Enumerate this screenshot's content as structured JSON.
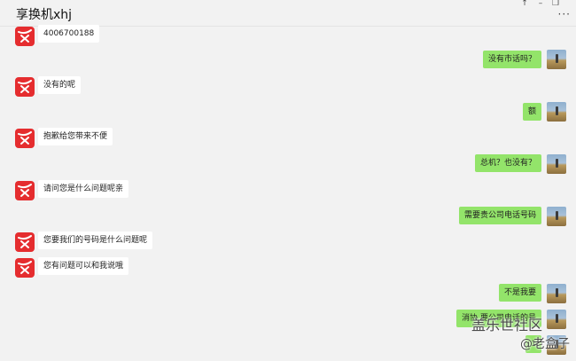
{
  "window": {
    "title": "享换机xhj",
    "controls": {
      "pin": "↑",
      "minimize": "–",
      "restore": "❐"
    },
    "more": "···"
  },
  "messages": [
    {
      "side": "left",
      "text": "4006700188"
    },
    {
      "side": "right",
      "text": "没有市话吗？"
    },
    {
      "side": "left",
      "text": "没有的呢"
    },
    {
      "side": "right",
      "text": "额"
    },
    {
      "side": "left",
      "text": "抱歉给您带来不便"
    },
    {
      "side": "right",
      "text": "总机？也没有？"
    },
    {
      "side": "left",
      "text": "请问您是什么问题呢亲"
    },
    {
      "side": "right",
      "text": "需要贵公司电话号码"
    },
    {
      "side": "left",
      "text": "您要我们的号码是什么问题呢"
    },
    {
      "side": "left",
      "text": "您有问题可以和我说哦"
    },
    {
      "side": "right",
      "text": "不是我要"
    },
    {
      "side": "right",
      "text": "消协 要公司电话的号"
    },
    {
      "side": "right",
      "text": "1"
    }
  ],
  "watermark": {
    "line1": "盖乐世社区",
    "line2": "@老盒子"
  },
  "colors": {
    "agent_avatar": "#e52d2f",
    "user_bubble": "#93e46a",
    "agent_bubble": "#ffffff"
  }
}
